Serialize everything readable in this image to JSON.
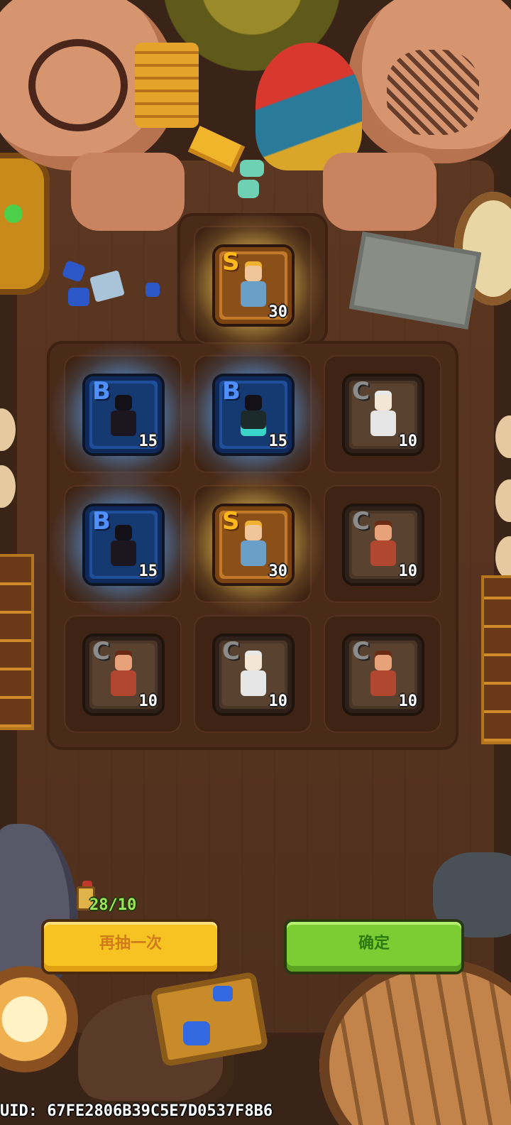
{
  "cards": [
    {
      "grade": "S",
      "count": "30",
      "hero": "fig-gold"
    },
    {
      "grade": "B",
      "count": "15",
      "hero": "fig-shadow"
    },
    {
      "grade": "B",
      "count": "15",
      "hero": "fig-shadow2"
    },
    {
      "grade": "C",
      "count": "10",
      "hero": "fig-priest"
    },
    {
      "grade": "B",
      "count": "15",
      "hero": "fig-shadow"
    },
    {
      "grade": "S",
      "count": "30",
      "hero": "fig-gold"
    },
    {
      "grade": "C",
      "count": "10",
      "hero": "fig-brawler"
    },
    {
      "grade": "C",
      "count": "10",
      "hero": "fig-brawler"
    },
    {
      "grade": "C",
      "count": "10",
      "hero": "fig-priest"
    },
    {
      "grade": "C",
      "count": "10",
      "hero": "fig-brawler"
    }
  ],
  "ticket": {
    "count": "28/10",
    "icon": "ticket-icon"
  },
  "buttons": {
    "draw_again": "再抽一次",
    "confirm": "确定"
  },
  "uid": {
    "label": "UID:",
    "value": "67FE2806B39C5E7D0537F8B6"
  },
  "colors": {
    "S": "#c27a2a",
    "B": "#1f4f9a",
    "C": "#4a3626",
    "yellow_button": "#f6c323",
    "green_button": "#7ccd33"
  }
}
